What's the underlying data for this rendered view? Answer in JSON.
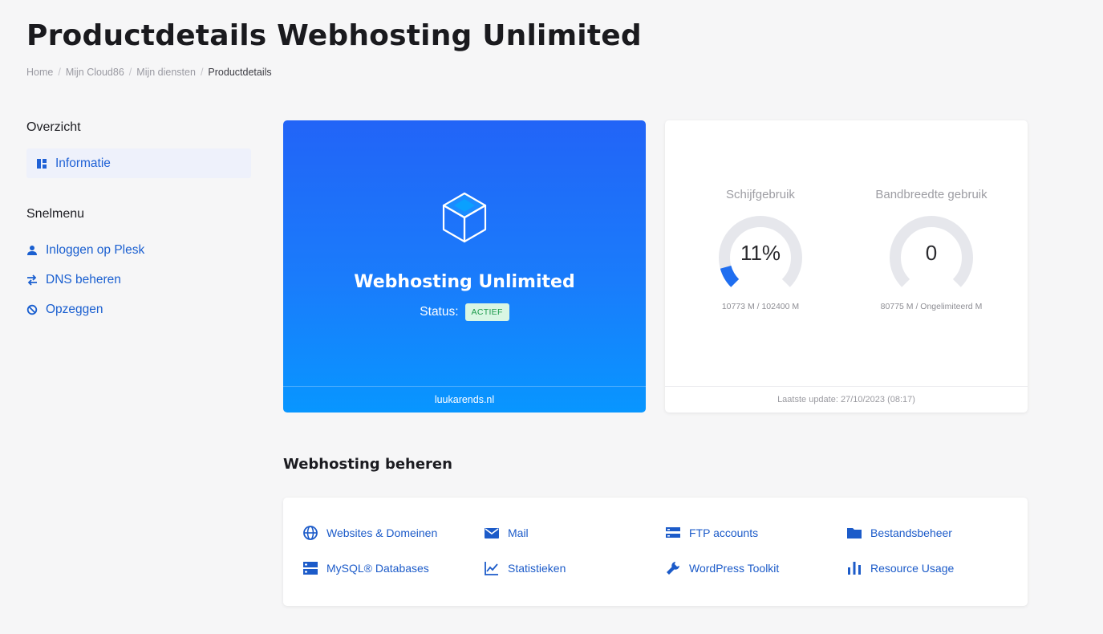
{
  "page": {
    "title": "Productdetails Webhosting Unlimited"
  },
  "breadcrumb": [
    {
      "label": "Home"
    },
    {
      "label": "Mijn Cloud86"
    },
    {
      "label": "Mijn diensten"
    },
    {
      "label": "Productdetails"
    }
  ],
  "sidebar": {
    "overview_heading": "Overzicht",
    "active_item": {
      "label": "Informatie",
      "icon": "dashboard-icon"
    },
    "quickmenu_heading": "Snelmenu",
    "links": [
      {
        "label": "Inloggen op Plesk",
        "icon": "user-icon"
      },
      {
        "label": "DNS beheren",
        "icon": "swap-arrows-icon"
      },
      {
        "label": "Opzeggen",
        "icon": "block-icon"
      }
    ]
  },
  "product": {
    "name": "Webhosting Unlimited",
    "status_label": "Status:",
    "status_value": "ACTIEF",
    "domain": "luukarends.nl",
    "icon": "cube-icon"
  },
  "usage": {
    "disk": {
      "title": "Schijfgebruik",
      "value": "11%",
      "fraction": 0.11,
      "detail": "10773 M / 102400 M"
    },
    "bandwidth": {
      "title": "Bandbreedte gebruik",
      "value": "0",
      "fraction": 0,
      "detail": "80775 M / Ongelimiteerd M"
    },
    "last_update": "Laatste update: 27/10/2023 (08:17)"
  },
  "manage": {
    "title": "Webhosting beheren",
    "items": [
      {
        "label": "Websites & Domeinen",
        "icon": "globe-icon"
      },
      {
        "label": "Mail",
        "icon": "mail-icon"
      },
      {
        "label": "FTP accounts",
        "icon": "ftp-server-icon"
      },
      {
        "label": "Bestandsbeheer",
        "icon": "folder-icon"
      },
      {
        "label": "MySQL® Databases",
        "icon": "database-icon"
      },
      {
        "label": "Statistieken",
        "icon": "line-chart-icon"
      },
      {
        "label": "WordPress Toolkit",
        "icon": "wrench-icon"
      },
      {
        "label": "Resource Usage",
        "icon": "bar-chart-icon"
      }
    ]
  },
  "colors": {
    "accent": "#1f61d6",
    "card_gradient_top": "#2264f7",
    "card_gradient_bottom": "#0896ff",
    "status_badge_bg": "#d9f6e3",
    "status_badge_text": "#1c9a4a",
    "gauge_track": "#e6e7ec",
    "gauge_fill": "#1f6ef0"
  }
}
